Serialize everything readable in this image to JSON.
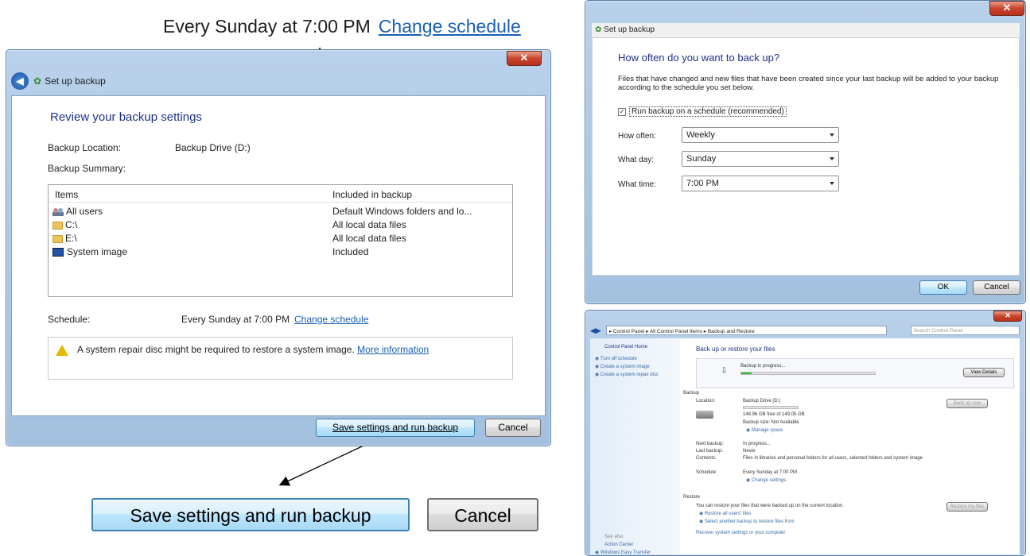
{
  "callout_top": {
    "text": "Every Sunday at 7:00 PM",
    "link": "Change schedule"
  },
  "main": {
    "nav_title": "Set up backup",
    "heading": "Review your backup settings",
    "location_label": "Backup Location:",
    "location_value": "Backup Drive (D:)",
    "summary_label": "Backup Summary:",
    "col_items": "Items",
    "col_included": "Included in backup",
    "rows": [
      {
        "item": "All users",
        "included": "Default Windows folders and lo...",
        "icon": "users-icon"
      },
      {
        "item": "C:\\",
        "included": "All local data files",
        "icon": "folder-icon"
      },
      {
        "item": "E:\\",
        "included": "All local data files",
        "icon": "folder-icon"
      },
      {
        "item": "System image",
        "included": "Included",
        "icon": "system-image-icon"
      }
    ],
    "schedule_label": "Schedule:",
    "schedule_value": "Every Sunday at 7:00 PM",
    "schedule_link": "Change schedule",
    "warning_text": "A system repair disc might be required to restore a system image.",
    "warning_link": "More information",
    "save_button": "Save settings and run backup",
    "cancel_button": "Cancel"
  },
  "callout_bottom": {
    "save": "Save settings and run backup",
    "cancel": "Cancel"
  },
  "schedule_dialog": {
    "title": "Set up backup",
    "heading": "How often do you want to back up?",
    "desc": "Files that have changed and new files that have been created since your last backup will be added to your backup according to the schedule you set below.",
    "checkbox_label": "Run backup on a schedule (recommended)",
    "checkbox_checked": true,
    "how_often_label": "How often:",
    "how_often_value": "Weekly",
    "what_day_label": "What day:",
    "what_day_value": "Sunday",
    "what_time_label": "What time:",
    "what_time_value": "7:00 PM",
    "ok": "OK",
    "cancel": "Cancel"
  },
  "control_panel": {
    "breadcrumb": [
      "Control Panel",
      "All Control Panel Items",
      "Backup and Restore"
    ],
    "search_placeholder": "Search Control Panel",
    "sidebar": [
      "Control Panel Home",
      "Turn off schedule",
      "Create a system image",
      "Create a system repair disc"
    ],
    "see_also": "See also",
    "sidebar_bottom": [
      "Action Center",
      "Windows Easy Transfer"
    ],
    "heading": "Back up or restore your files",
    "progress_label": "Backup in progress...",
    "view_details": "View Details",
    "backup_section": "Backup",
    "location_label": "Location:",
    "location_value": "Backup Drive (D:)",
    "free_space": "148.96 GB free of 149.05 GB",
    "backup_size": "Backup size: Not Available",
    "manage_space": "Manage space",
    "back_up_now": "Back up now",
    "next_backup_label": "Next backup:",
    "next_backup_value": "In progress...",
    "last_backup_label": "Last backup:",
    "last_backup_value": "Never",
    "contents_label": "Contents:",
    "contents_value": "Files in libraries and personal folders for all users, selected folders and system image",
    "schedule_label": "Schedule:",
    "schedule_value": "Every Sunday at 7:00 PM",
    "change_settings": "Change settings",
    "restore_section": "Restore",
    "restore_text": "You can restore your files that were backed up on the current location.",
    "restore_my_files": "Restore my files",
    "restore_all_users": "Restore all users' files",
    "select_another": "Select another backup to restore files from",
    "recover_link": "Recover system settings or your computer",
    "progress": 0.08
  }
}
